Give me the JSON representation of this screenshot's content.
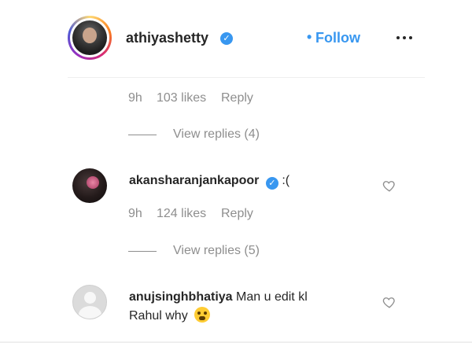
{
  "header": {
    "username": "athiyashetty",
    "separator": "•",
    "follow_label": "Follow",
    "verified_mark": "✓",
    "more_icon": "more-horizontal-icon"
  },
  "top_meta": {
    "time": "9h",
    "likes": "103 likes",
    "reply_label": "Reply"
  },
  "view_replies_1": {
    "label": "View replies (4)"
  },
  "comments": [
    {
      "username": "akansharanjankapoor",
      "verified": true,
      "text": ":(",
      "time": "9h",
      "likes": "124 likes",
      "reply_label": "Reply",
      "view_replies": "View replies (5)"
    },
    {
      "username": "anujsinghbhatiya",
      "verified": false,
      "text_line1": "Man u edit kl",
      "text_line2": "Rahul why"
    }
  ],
  "colors": {
    "accent": "#3897f0",
    "text": "#262626",
    "muted": "#8e8e8e"
  }
}
